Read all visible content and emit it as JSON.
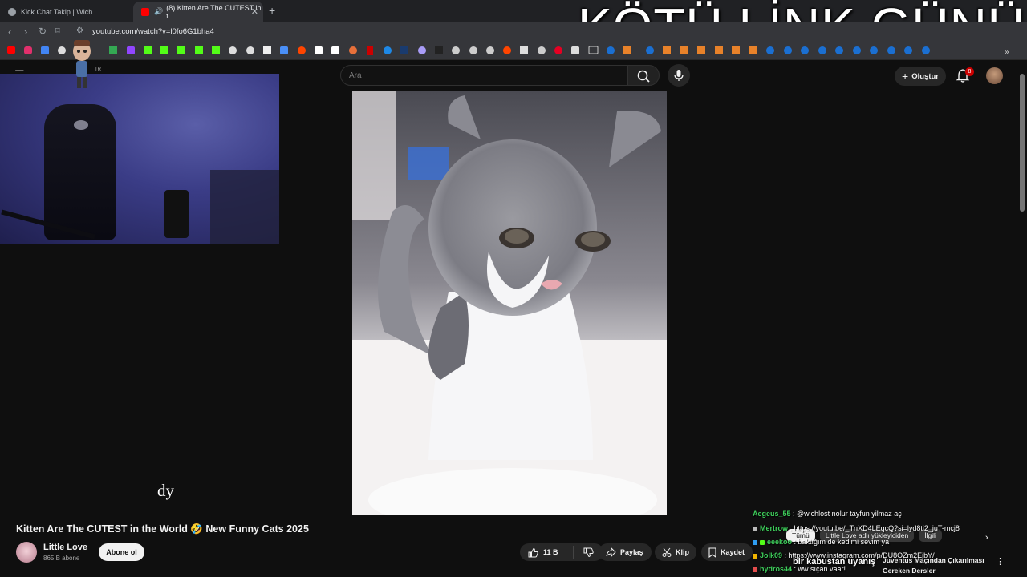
{
  "browser": {
    "tabs": [
      {
        "title": "Kick Chat Takip | Wich",
        "active": false
      },
      {
        "title": "(8) Kitten Are The CUTEST in t",
        "active": true
      }
    ],
    "url": "youtube.com/watch?v=l0fo6G1bha4"
  },
  "overlay": {
    "title": "KÖTÜ LİNK GÜNÜ",
    "subtitle": "dy",
    "banner": "bir kabustan uyanış"
  },
  "yt": {
    "logo_region_code": "TR",
    "search_placeholder": "Ara",
    "create_label": "Oluştur",
    "notification_count": "8",
    "video_title": "Kitten Are The CUTEST in the World 🤣 New Funny Cats 2025",
    "channel_name": "Little Love",
    "subscriber_count": "865 B abone",
    "subscribe_label": "Abone ol",
    "like_count": "11 B",
    "share_label": "Paylaş",
    "clip_label": "Klip",
    "save_label": "Kaydet",
    "chips": [
      "Tümü",
      "Little Love adlı yükleyiciden",
      "İlgili"
    ],
    "rec_title": "Juventus Maçından Çıkarılması Gereken Dersler"
  },
  "chat": [
    {
      "user": "Aegeus_55",
      "text": " : @wichlost nolur tayfun yilmaz aç",
      "color": "#2ea043"
    },
    {
      "user": "Mertrow",
      "text": " : https://youtu.be/_TnXD4LEqcQ?si=lyd8ti2_juT-mcj8",
      "color": "#2ea043"
    },
    {
      "user": "eeekoo",
      "text": " : baktığım de kedimi sevim ya",
      "color": "#2ea043"
    },
    {
      "user": "Jolk09",
      "text": " : https://www.instagram.com/p/DU8OZm2EjbY/",
      "color": "#2ea043"
    },
    {
      "user": "hydros44",
      "text": " : ww sıçan vaar!",
      "color": "#2ea043"
    }
  ],
  "colors": {
    "yt_red": "#ff0000",
    "bg": "#0f0f0f",
    "notif_badge": "#cc0000"
  }
}
